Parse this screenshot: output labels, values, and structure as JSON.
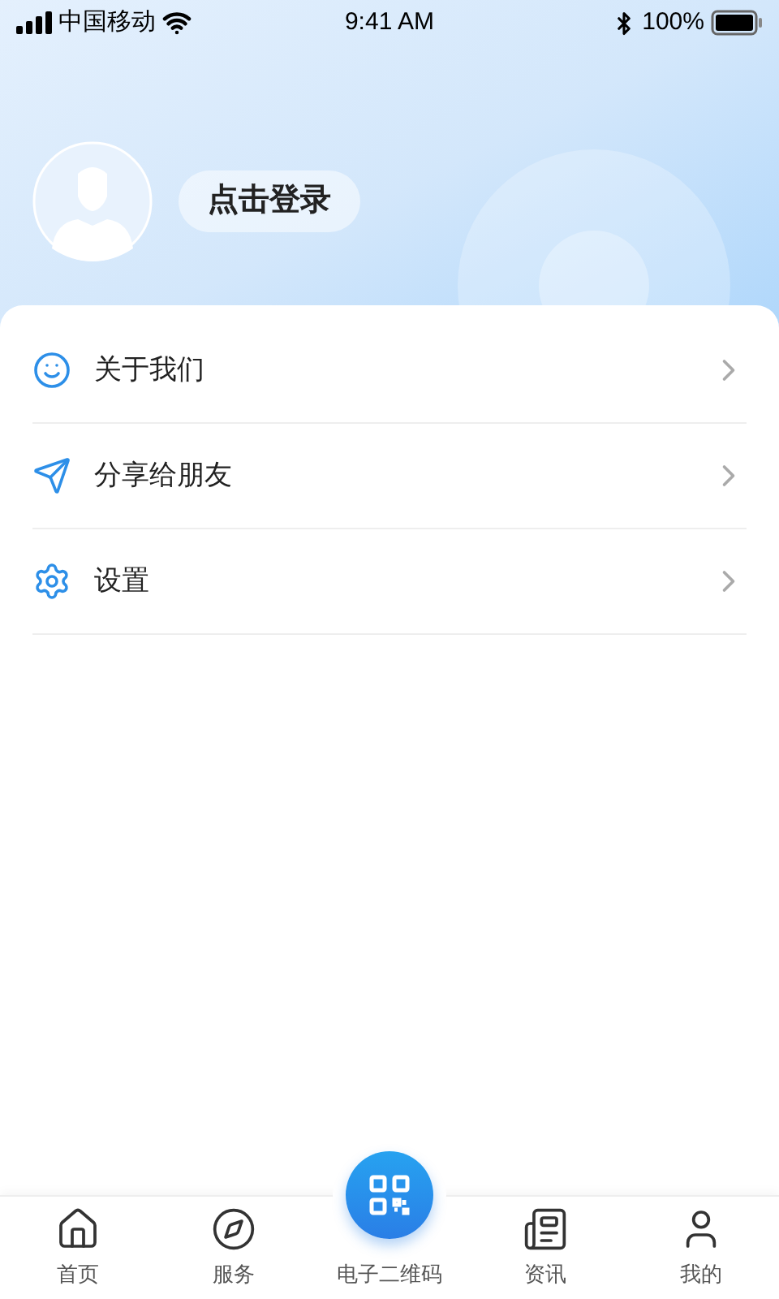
{
  "status_bar": {
    "carrier": "中国移动",
    "time": "9:41 AM",
    "battery": "100%"
  },
  "profile": {
    "login_button": "点击登录"
  },
  "menu": [
    {
      "kind": "smile",
      "label": "关于我们"
    },
    {
      "kind": "send",
      "label": "分享给朋友"
    },
    {
      "kind": "gear",
      "label": "设置"
    }
  ],
  "tab_bar": [
    {
      "kind": "home",
      "label": "首页"
    },
    {
      "kind": "compass",
      "label": "服务"
    },
    {
      "kind": "qr",
      "label": "电子二维码"
    },
    {
      "kind": "news",
      "label": "资讯"
    },
    {
      "kind": "user",
      "label": "我的"
    }
  ]
}
